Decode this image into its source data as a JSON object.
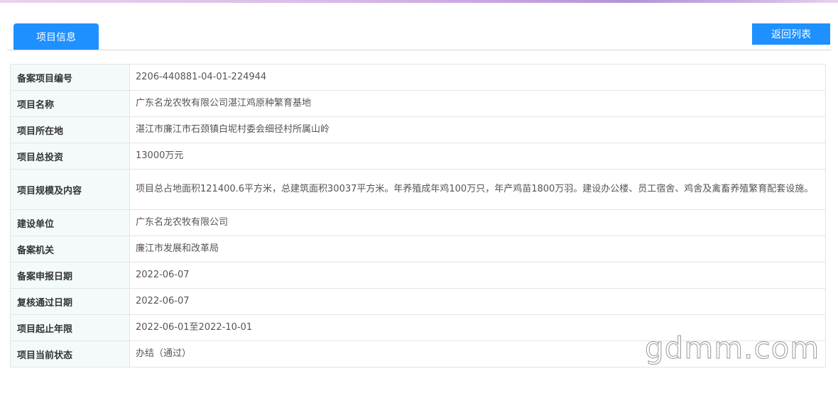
{
  "tab": {
    "label": "项目信息"
  },
  "actions": {
    "back_label": "返回列表"
  },
  "rows": [
    {
      "label": "备案项目编号",
      "value": "2206-440881-04-01-224944"
    },
    {
      "label": "项目名称",
      "value": "广东名龙农牧有限公司湛江鸡原种繁育基地"
    },
    {
      "label": "项目所在地",
      "value": "湛江市廉江市石颈镇白坭村委会细径村所属山岭"
    },
    {
      "label": "项目总投资",
      "value": "13000万元"
    },
    {
      "label": "项目规模及内容",
      "value": "项目总占地面积121400.6平方米，总建筑面积30037平方米。年养殖成年鸡100万只，年产鸡苗1800万羽。建设办公楼、员工宿舍、鸡舍及禽畜养殖繁育配套设施。"
    },
    {
      "label": "建设单位",
      "value": "广东名龙农牧有限公司"
    },
    {
      "label": "备案机关",
      "value": "廉江市发展和改革局"
    },
    {
      "label": "备案申报日期",
      "value": "2022-06-07"
    },
    {
      "label": "复核通过日期",
      "value": "2022-06-07"
    },
    {
      "label": "项目起止年限",
      "value": "2022-06-01至2022-10-01"
    },
    {
      "label": "项目当前状态",
      "value": "办结（通过）"
    }
  ],
  "watermark": {
    "text": "gdmm.com"
  },
  "colors": {
    "accent": "#1e90ff",
    "label_bg": "#f4fafb",
    "border": "#e4e4e4"
  }
}
